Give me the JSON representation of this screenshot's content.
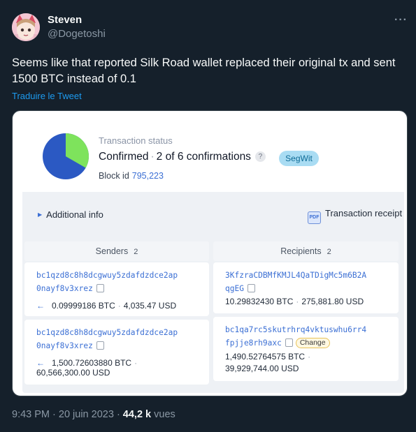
{
  "author": {
    "name": "Steven",
    "handle": "@Dogetoshi",
    "more_icon": "···"
  },
  "tweet": {
    "text": "Seems like that reported Silk Road wallet replaced their original tx and sent 1500 BTC instead of 0.1",
    "translate_link": "Traduire le Tweet"
  },
  "card": {
    "status_label": "Transaction status",
    "confirmed": "Confirmed",
    "confirmations": "2 of 6 confirmations",
    "help_icon": "?",
    "badge": "SegWit",
    "block_label": "Block id",
    "block_id": "795,223",
    "confirmation_fraction": 0.333,
    "additional_info": "Additional info",
    "receipt": "Transaction receipt",
    "pdf_icon": "PDF",
    "colors": {
      "pie_confirmed": "#7ee35c",
      "pie_pending": "#2b59c3",
      "accent": "#3b6fd4"
    },
    "senders": {
      "label": "Senders",
      "count": "2",
      "items": [
        {
          "address_line1": "bc1qzd8c8h8dcgwuy5zdafdzdce2ap",
          "address_line2": "0nayf8v3xrez",
          "btc": "0.09999186 BTC",
          "usd": "4,035.47 USD"
        },
        {
          "address_line1": "bc1qzd8c8h8dcgwuy5zdafdzdce2ap",
          "address_line2": "0nayf8v3xrez",
          "btc": "1,500.72603880 BTC",
          "usd": "60,566,300.00 USD"
        }
      ]
    },
    "recipients": {
      "label": "Recipients",
      "count": "2",
      "items": [
        {
          "address_line1": "3KfzraCDBMfKMJL4QaTDigMc5m6B2A",
          "address_line2": "qgEG",
          "btc": "10.29832430 BTC",
          "usd": "275,881.80 USD"
        },
        {
          "address_line1": "bc1qa7rc5skutrhrq4vktuswhu6rr4",
          "address_line2": "fpjje8rh9axc",
          "tag": "Change",
          "btc": "1,490.52764575 BTC",
          "usd": "39,929,744.00 USD"
        }
      ]
    }
  },
  "footer": {
    "time": "9:43 PM",
    "date": "20 juin 2023",
    "views_count": "44,2 k",
    "views_label": "vues"
  }
}
